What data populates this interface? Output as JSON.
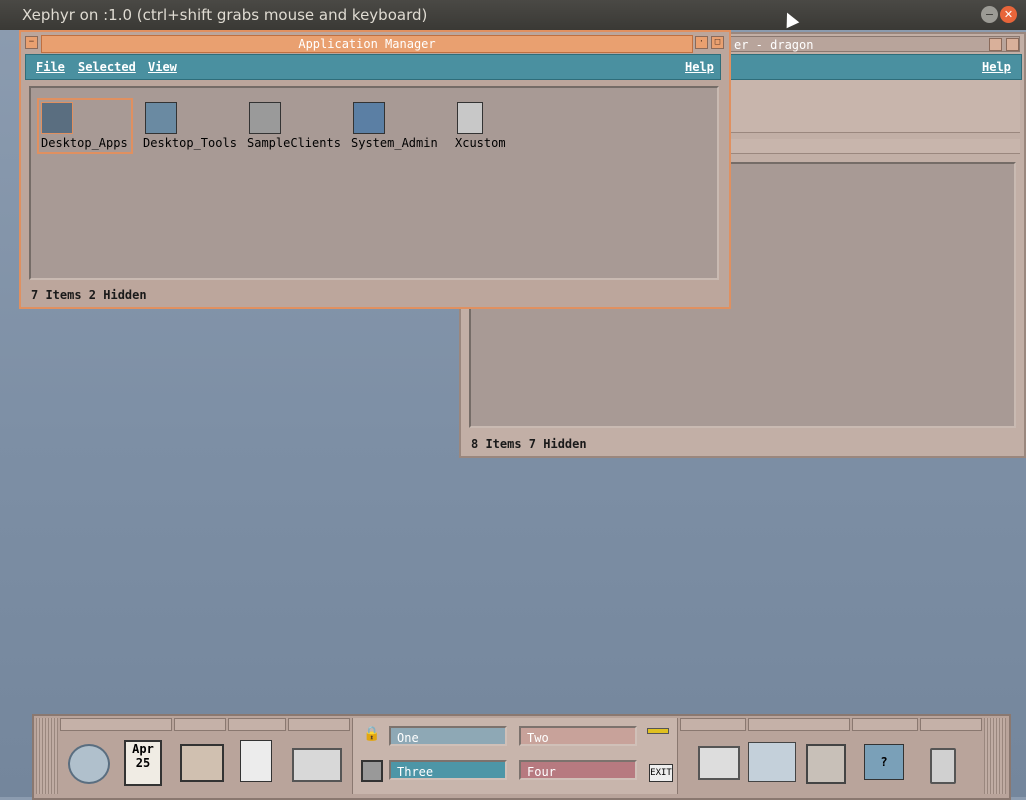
{
  "host": {
    "title": "Xephyr on :1.0 (ctrl+shift grabs mouse and keyboard)",
    "min_glyph": "−",
    "close_glyph": "✕"
  },
  "back_window": {
    "title": "er - dragon",
    "help": "Help",
    "status": "8 Items 7 Hidden"
  },
  "front_window": {
    "title": "Application Manager",
    "menu": {
      "file": "File",
      "selected": "Selected",
      "view": "View",
      "help": "Help"
    },
    "icons": [
      "Desktop_Apps",
      "Desktop_Tools",
      "SampleClients",
      "System_Admin",
      "Xcustom"
    ],
    "status": "7 Items 2 Hidden"
  },
  "panel": {
    "date_month": "Apr",
    "date_day": "25",
    "workspaces": {
      "one": "One",
      "two": "Two",
      "three": "Three",
      "four": "Four"
    },
    "exit_label": "EXIT",
    "colors": {
      "one": "#8ea8b5",
      "two": "#c8a29a",
      "three": "#4d96a7",
      "four": "#b77a80"
    }
  }
}
